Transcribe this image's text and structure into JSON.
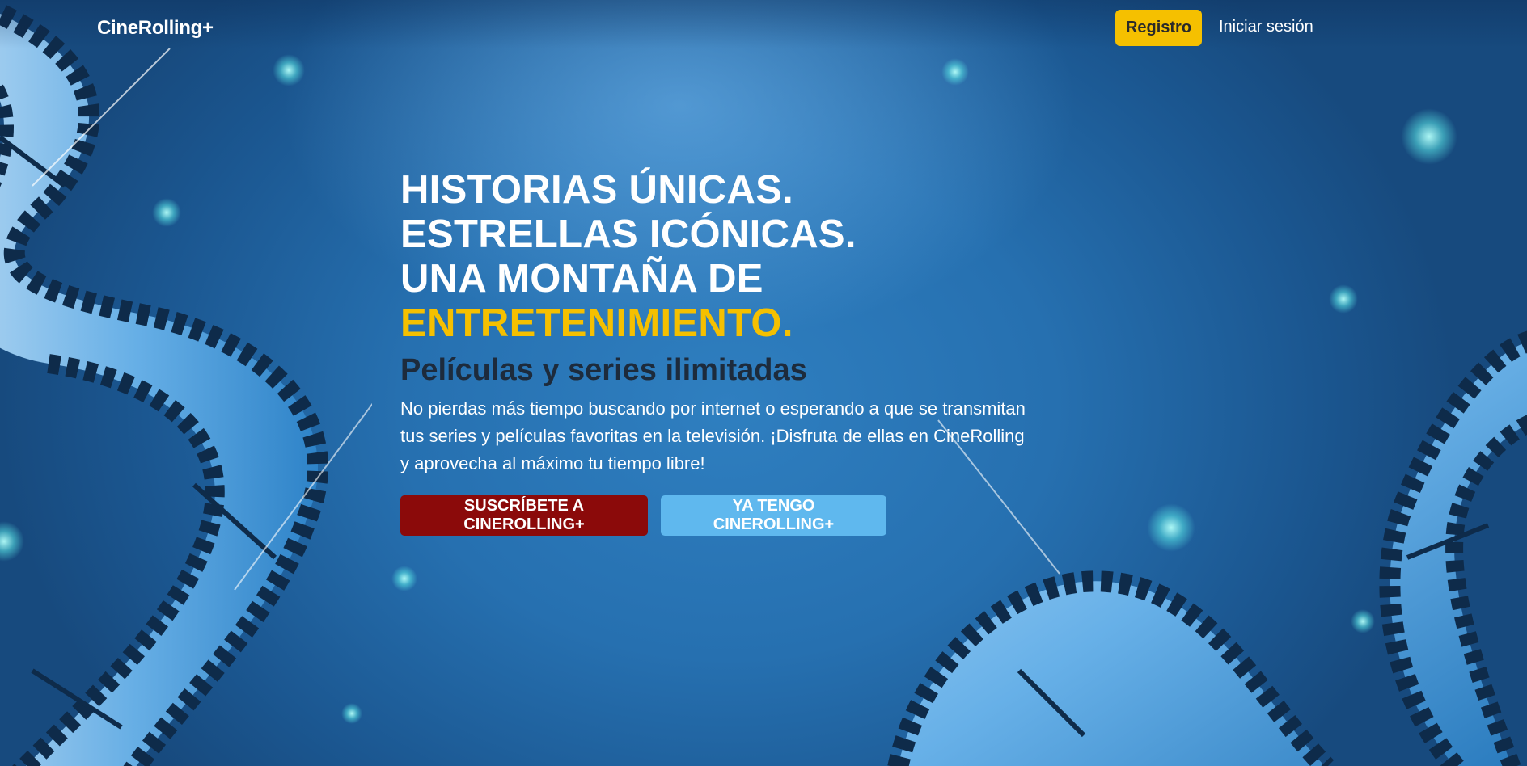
{
  "nav": {
    "brand": "CineRolling+",
    "register_label": "Registro",
    "login_label": "Iniciar sesión"
  },
  "hero": {
    "headline_lines": [
      "HISTORIAS ÚNICAS.",
      "ESTRELLAS ICÓNICAS.",
      "UNA MONTAÑA DE"
    ],
    "headline_accent": "ENTRETENIMIENTO.",
    "subtitle": "Películas y series ilimitadas",
    "description": "No pierdas más tiempo buscando por internet o esperando a que se transmitan tus series y películas favoritas en la televisión. ¡Disfruta de ellas en CineRolling y aprovecha al máximo tu tiempo libre!",
    "primary_cta": "SUSCRÍBETE A CINEROLLING+",
    "secondary_cta": "YA TENGO CINEROLLING+"
  },
  "colors": {
    "accent_yellow": "#f5c000",
    "cta_red": "#8b0a0a",
    "cta_light_blue": "#5fb8ee",
    "background_blue": "#2670b0"
  },
  "background": {
    "decoration_icon": "film-reel-icon"
  }
}
